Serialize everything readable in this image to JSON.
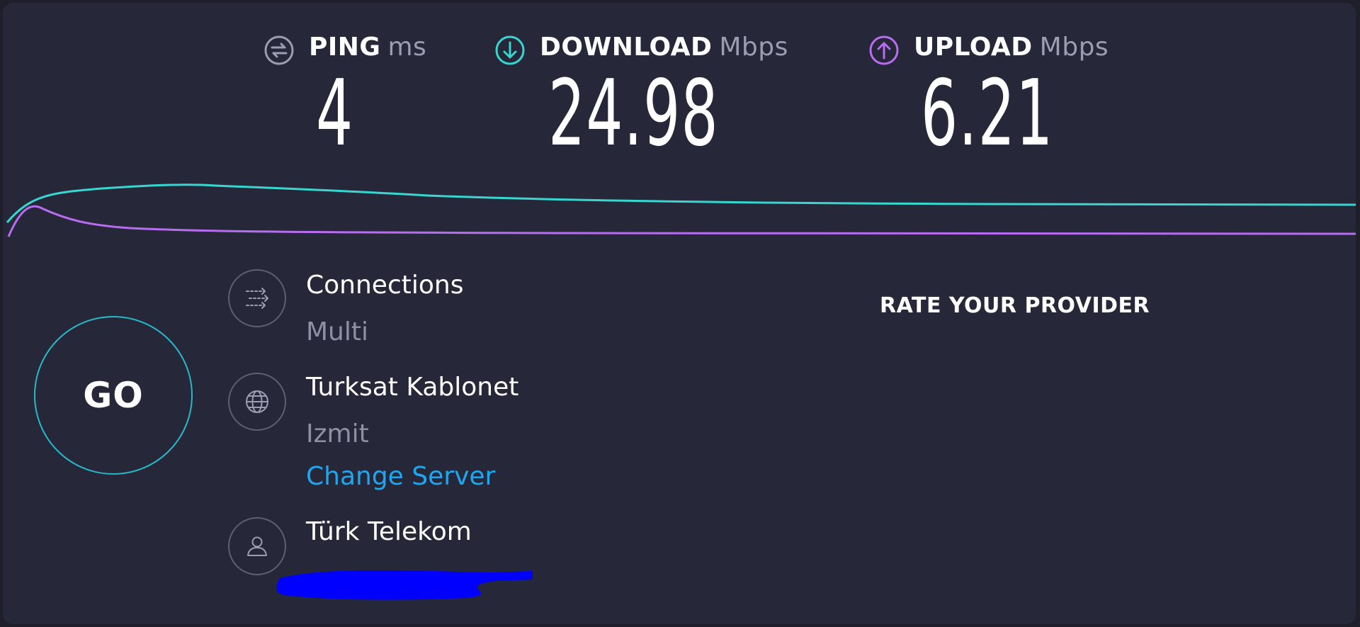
{
  "metrics": {
    "ping": {
      "label": "PING",
      "unit": "ms",
      "value": "4",
      "icon": "ping-icon",
      "color": "#9b9db1"
    },
    "download": {
      "label": "DOWNLOAD",
      "unit": "Mbps",
      "value": "24.98",
      "icon": "download-icon",
      "color": "#37d6d0"
    },
    "upload": {
      "label": "UPLOAD",
      "unit": "Mbps",
      "value": "6.21",
      "icon": "upload-icon",
      "color": "#b86cf0"
    }
  },
  "go_button": {
    "label": "GO",
    "ring_color": "#26b9c9"
  },
  "connections": {
    "title": "Connections",
    "value": "Multi",
    "icon": "connections-icon"
  },
  "server": {
    "name": "Turksat Kablonet",
    "location": "Izmit",
    "change_label": "Change Server",
    "icon": "globe-icon"
  },
  "provider": {
    "name": "Türk Telekom",
    "icon": "user-icon"
  },
  "rate_provider": {
    "label": "RATE YOUR PROVIDER"
  },
  "colors": {
    "background": "#262839",
    "download_line": "#37d6d0",
    "upload_line": "#b86cf0",
    "link": "#1ea7f0",
    "redaction": "#0000ff"
  }
}
